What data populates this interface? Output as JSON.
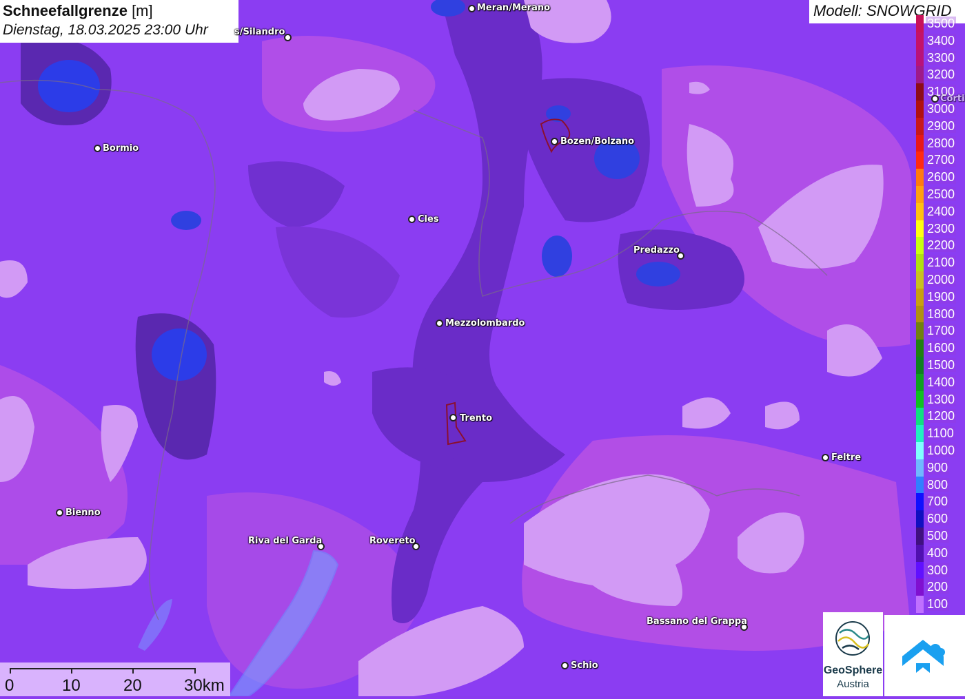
{
  "title": {
    "bold": "Schneefallgrenze",
    "unit": " [m]",
    "subtitle": "Dienstag, 18.03.2025 23:00 Uhr"
  },
  "model": "Modell: SNOWGRID",
  "legend": {
    "values": [
      "3500",
      "3400",
      "3300",
      "3200",
      "3100",
      "3000",
      "2900",
      "2800",
      "2700",
      "2600",
      "2500",
      "2400",
      "2300",
      "2200",
      "2100",
      "2000",
      "1900",
      "1800",
      "1700",
      "1600",
      "1500",
      "1400",
      "1300",
      "1200",
      "1100",
      "1000",
      "900",
      "800",
      "700",
      "600",
      "500",
      "400",
      "300",
      "200",
      "100"
    ],
    "colors": [
      "#c8125a",
      "#c41268",
      "#b8127a",
      "#9e1a8a",
      "#8c0c18",
      "#b01010",
      "#c81818",
      "#e81818",
      "#ff2a10",
      "#ff7a10",
      "#ffa010",
      "#ffc010",
      "#ffff10",
      "#c8ff10",
      "#b0e010",
      "#c8c020",
      "#c8a010",
      "#b09010",
      "#708010",
      "#208010",
      "#108020",
      "#10a020",
      "#10c020",
      "#10e080",
      "#20f0c0",
      "#80ffff",
      "#70b8ff",
      "#3080ff",
      "#1010ff",
      "#1010c0",
      "#401080",
      "#5010b0",
      "#6010ff",
      "#8010d0",
      "#c070ff"
    ]
  },
  "cities": [
    {
      "id": "meran",
      "label": "Meran/Merano"
    },
    {
      "id": "silandro",
      "label": "s/Silandro"
    },
    {
      "id": "bormio",
      "label": "Bormio"
    },
    {
      "id": "bozen",
      "label": "Bozen/Bolzano"
    },
    {
      "id": "cles",
      "label": "Cles"
    },
    {
      "id": "predazzo",
      "label": "Predazzo"
    },
    {
      "id": "mezzolombardo",
      "label": "Mezzolombardo"
    },
    {
      "id": "trento",
      "label": "Trento"
    },
    {
      "id": "feltre",
      "label": "Feltre"
    },
    {
      "id": "bienno",
      "label": "Bienno"
    },
    {
      "id": "riva",
      "label": "Riva del Garda"
    },
    {
      "id": "rovereto",
      "label": "Rovereto"
    },
    {
      "id": "bassano",
      "label": "Bassano del Grappa"
    },
    {
      "id": "schio",
      "label": "Schio"
    },
    {
      "id": "cortina",
      "label": "Corti"
    }
  ],
  "scale": {
    "labels": [
      "0",
      "10",
      "20",
      "30km"
    ]
  },
  "logos": {
    "geosphere_line1": "GeoSphere",
    "geosphere_line2": "Austria"
  }
}
